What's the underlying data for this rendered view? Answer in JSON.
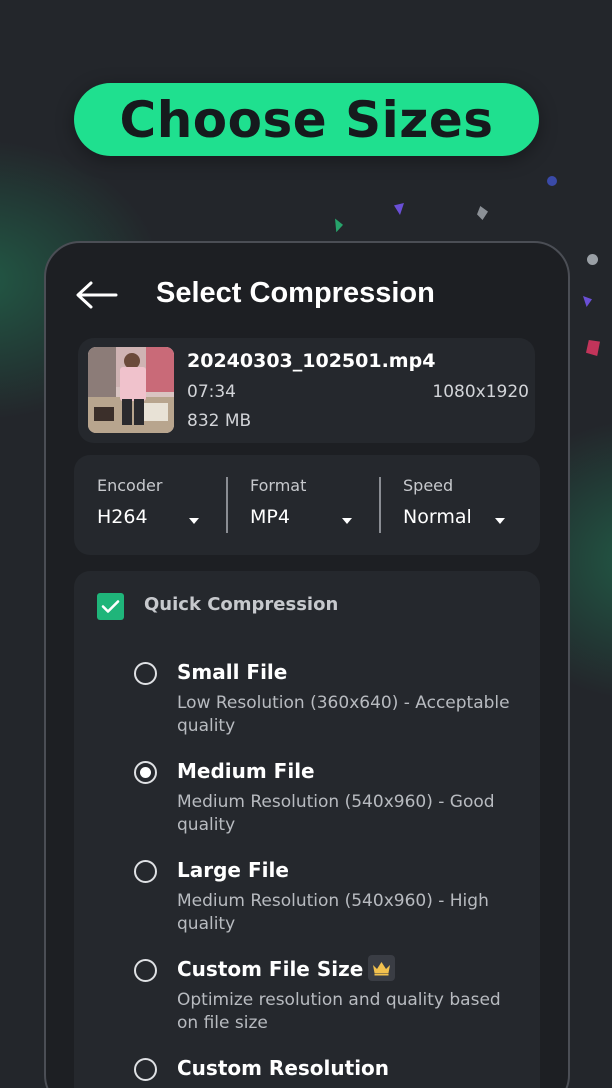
{
  "banner": {
    "text": "Choose Sizes"
  },
  "screen": {
    "title": "Select Compression"
  },
  "file": {
    "name": "20240303_102501.mp4",
    "duration": "07:34",
    "resolution": "1080x1920",
    "size": "832 MB"
  },
  "settings": {
    "encoder": {
      "label": "Encoder",
      "value": "H264"
    },
    "format": {
      "label": "Format",
      "value": "MP4"
    },
    "speed": {
      "label": "Speed",
      "value": "Normal"
    }
  },
  "quick": {
    "label": "Quick Compression",
    "checked": true
  },
  "options": [
    {
      "title": "Small File",
      "desc": "Low Resolution (360x640) - Acceptable quality",
      "selected": false
    },
    {
      "title": "Medium File",
      "desc": "Medium Resolution (540x960) - Good quality",
      "selected": true
    },
    {
      "title": "Large File",
      "desc": "Medium Resolution (540x960) - High quality",
      "selected": false
    },
    {
      "title": "Custom File Size",
      "desc": "Optimize resolution and quality based on file size",
      "selected": false,
      "premium": true
    },
    {
      "title": "Custom Resolution",
      "desc": "",
      "selected": false
    }
  ],
  "colors": {
    "accent": "#1fe08f",
    "check": "#1fb57a",
    "background": "#23262b",
    "card": "#25282d"
  },
  "icons": {
    "back": "arrow-left-icon",
    "premium": "crown-icon",
    "dropdown": "caret-down-icon"
  }
}
